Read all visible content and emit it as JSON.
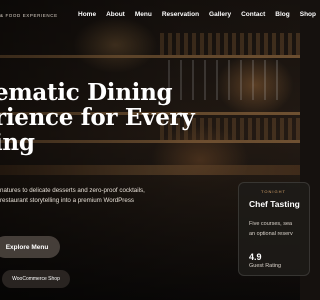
{
  "brand": {
    "tagline": "& FOOD EXPERIENCE"
  },
  "nav": [
    "Home",
    "About",
    "Menu",
    "Reservation",
    "Gallery",
    "Contact",
    "Blog",
    "Shop"
  ],
  "hero": {
    "title_lines": [
      "ematic Dining",
      "rience for Every",
      "ing"
    ],
    "description_lines": [
      "natures to delicate desserts and zero-proof cocktails,",
      "restaurant storytelling into a premium WordPress"
    ]
  },
  "buttons": {
    "explore": "Explore Menu",
    "woo": "WooCommerce Shop"
  },
  "card": {
    "kicker": "TONIGHT",
    "title": "Chef Tasting",
    "description_lines": [
      "Five courses, sea",
      "an optional reserv"
    ],
    "rating": "4.9",
    "rating_label": "Guest Rating"
  }
}
